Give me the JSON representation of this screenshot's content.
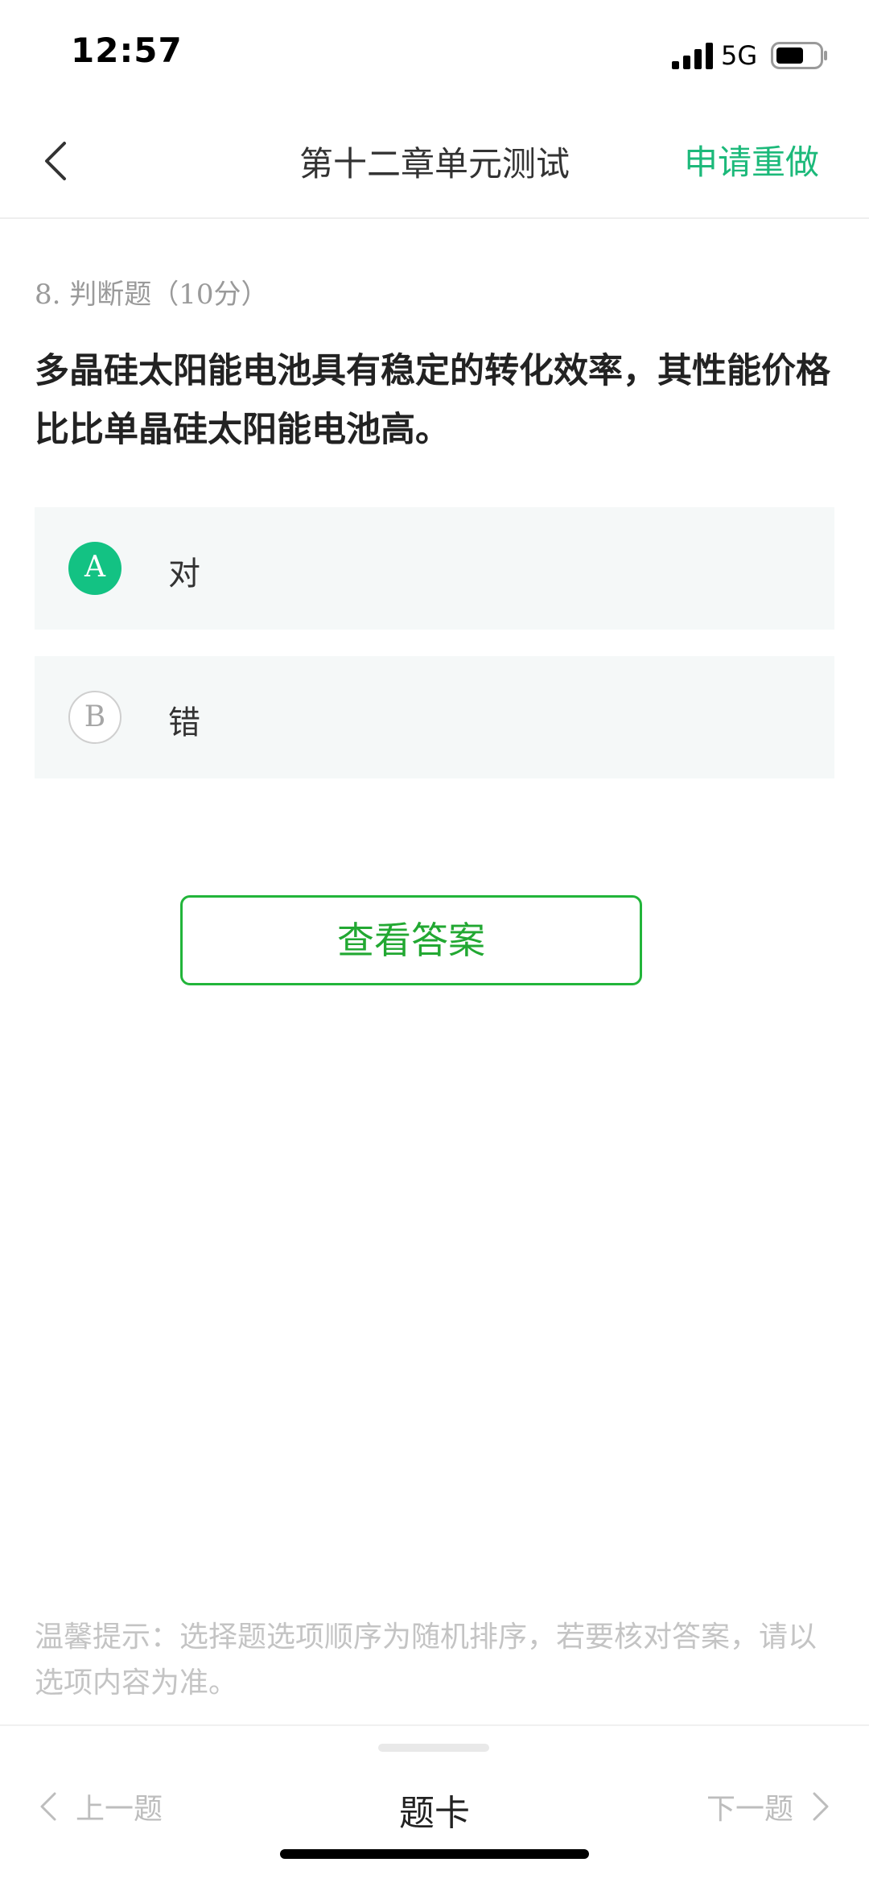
{
  "status_bar": {
    "time": "12:57",
    "network": "5G",
    "signal_icon": "cellular-signal-icon",
    "battery_icon": "battery-icon"
  },
  "nav": {
    "back_icon": "chevron-left-icon",
    "title": "第十二章单元测试",
    "redo_label": "申请重做"
  },
  "question": {
    "meta": "8. 判断题（10分）",
    "text": "多晶硅太阳能电池具有稳定的转化效率，其性能价格比比单晶硅太阳能电池高。",
    "options": [
      {
        "letter": "A",
        "text": "对",
        "selected": true
      },
      {
        "letter": "B",
        "text": "错",
        "selected": false
      }
    ]
  },
  "answer_button_label": "查看答案",
  "tip": "温馨提示：选择题选项顺序为随机排序，若要核对答案，请以选项内容为准。",
  "bottom_nav": {
    "prev_label": "上一题",
    "card_label": "题卡",
    "next_label": "下一题"
  },
  "colors": {
    "accent": "#1cb97a",
    "selected_option": "#13c283",
    "answer_button": "#22b53a",
    "option_bg": "#f5f8f8"
  }
}
